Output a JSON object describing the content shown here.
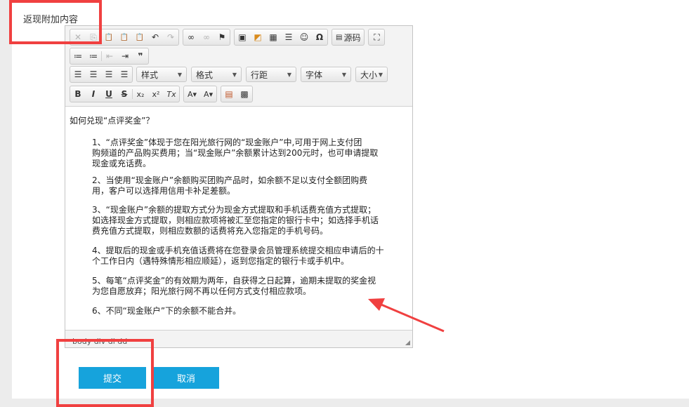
{
  "form": {
    "field_label": "返现附加内容",
    "submit_label": "提交",
    "cancel_label": "取消"
  },
  "toolbar": {
    "row1": [
      {
        "icon": "cut-icon",
        "glyph": "✕",
        "disabled": true
      },
      {
        "icon": "copy-icon",
        "glyph": "⎘",
        "disabled": true
      },
      {
        "icon": "paste-icon",
        "glyph": "📋"
      },
      {
        "icon": "paste-text-icon",
        "glyph": "📋"
      },
      {
        "icon": "paste-word-icon",
        "glyph": "📋"
      },
      {
        "icon": "undo-icon",
        "glyph": "↶"
      },
      {
        "icon": "redo-icon",
        "glyph": "↷",
        "disabled": true
      },
      {
        "icon": "link-icon",
        "glyph": "∞"
      },
      {
        "icon": "unlink-icon",
        "glyph": "∞",
        "disabled": true
      },
      {
        "icon": "anchor-flag-icon",
        "glyph": "⚑"
      },
      {
        "icon": "image-icon",
        "glyph": "▣"
      },
      {
        "icon": "flash-icon",
        "glyph": "◩"
      },
      {
        "icon": "table-icon",
        "glyph": "▦"
      },
      {
        "icon": "horizontal-rule-icon",
        "glyph": "☰"
      },
      {
        "icon": "smiley-icon",
        "glyph": "☺"
      },
      {
        "icon": "special-char-icon",
        "glyph": "Ω"
      }
    ],
    "source_label": "源码",
    "maximize_glyph": "⛶",
    "row2": [
      {
        "icon": "numbered-list-icon",
        "glyph": "≔"
      },
      {
        "icon": "bulleted-list-icon",
        "glyph": "≔"
      },
      {
        "icon": "outdent-icon",
        "glyph": "⇤",
        "disabled": true
      },
      {
        "icon": "indent-icon",
        "glyph": "⇥"
      },
      {
        "icon": "blockquote-icon",
        "glyph": "❞"
      }
    ],
    "row3_align": [
      {
        "icon": "align-left-icon",
        "glyph": "☰"
      },
      {
        "icon": "align-center-icon",
        "glyph": "☰"
      },
      {
        "icon": "align-right-icon",
        "glyph": "☰"
      },
      {
        "icon": "align-justify-icon",
        "glyph": "☰"
      }
    ],
    "combos": [
      "样式",
      "格式",
      "行距",
      "字体",
      "大小"
    ],
    "row4": [
      {
        "icon": "bold-icon",
        "glyph": "B"
      },
      {
        "icon": "italic-icon",
        "glyph": "I"
      },
      {
        "icon": "underline-icon",
        "glyph": "U"
      },
      {
        "icon": "strike-icon",
        "glyph": "S"
      },
      {
        "icon": "subscript-icon",
        "glyph": "x₂"
      },
      {
        "icon": "superscript-icon",
        "glyph": "x²"
      },
      {
        "icon": "remove-format-icon",
        "glyph": "Tx"
      },
      {
        "icon": "text-color-icon",
        "glyph": "A▾"
      },
      {
        "icon": "bg-color-icon",
        "glyph": "A▾"
      },
      {
        "icon": "template-icon",
        "glyph": "▤"
      },
      {
        "icon": "qrcode-icon",
        "glyph": "▩"
      }
    ]
  },
  "content": {
    "heading": "如何兑现“点评奖金”？",
    "paragraphs": [
      [
        "1、“点评奖金”体现于您在阳光旅行网的“现金账户”中,可用于网上支付团",
        "购频道的产品购买费用；当“现金账户”余额累计达到200元时，也可申请提取",
        "现金或充话费。"
      ],
      [
        "2、当使用“现金账户”余额购买团购产品时，如余额不足以支付全额团购费",
        "用，客户可以选择用信用卡补足差额。"
      ],
      [
        "3、“现金账户”余额的提取方式分为现金方式提取和手机话费充值方式提取；",
        "如选择现金方式提取，则相应款项将被汇至您指定的银行卡中；如选择手机话",
        "费充值方式提取，则相应数额的话费将充入您指定的手机号码。"
      ],
      [
        "4、提取后的现金或手机充值话费将在您登录会员管理系统提交相应申请后的十",
        "个工作日内（遇特殊情形相应顺延），返到您指定的银行卡或手机中。"
      ],
      [
        "5、每笔“点评奖金”的有效期为两年，自获得之日起算，逾期未提取的奖金视",
        "为您自愿放弃；阳光旅行网不再以任何方式支付相应款项。"
      ],
      [
        "6、不同“现金账户”下的余额不能合并。"
      ]
    ]
  },
  "status": {
    "path": "body  div  dl  dd"
  },
  "colors": {
    "accent": "#16a3dc",
    "annotation": "#f04040"
  }
}
